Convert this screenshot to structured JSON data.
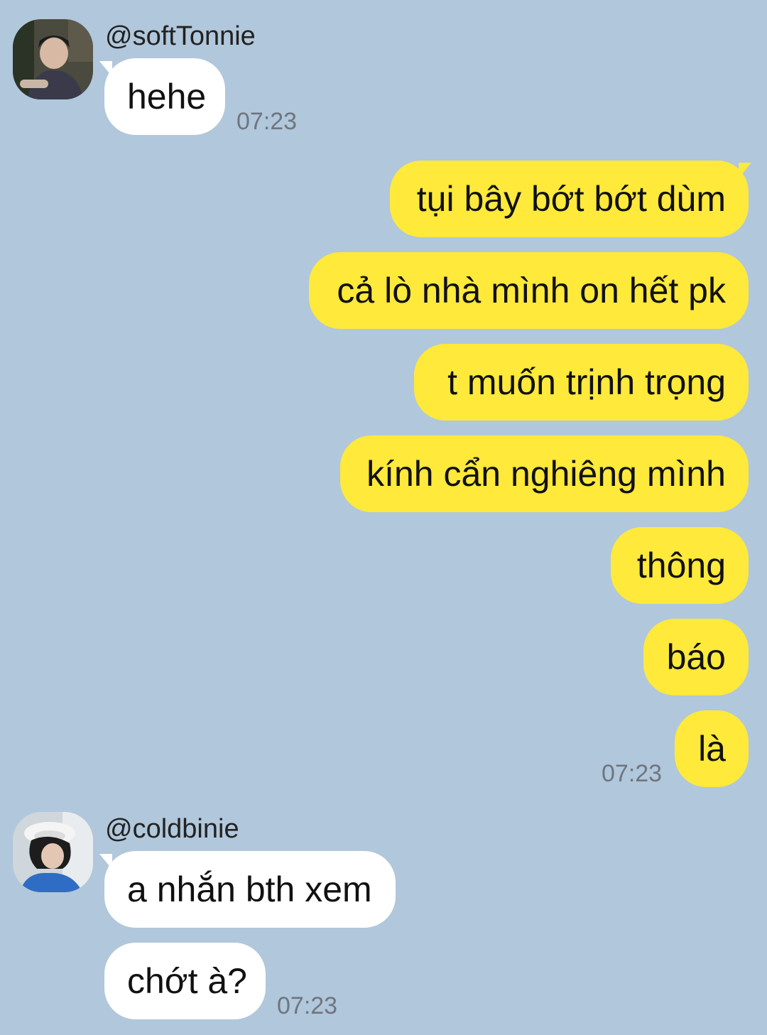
{
  "colors": {
    "background": "#b1c7db",
    "incoming_bubble": "#ffffff",
    "outgoing_bubble": "#ffe93a",
    "timestamp": "#6e7680"
  },
  "groups": [
    {
      "sender": "@softTonnie",
      "avatar": "avatar-photo",
      "messages": [
        "hehe"
      ],
      "time": "07:23"
    },
    {
      "sender": "me",
      "messages": [
        "tụi bây bớt bớt dùm",
        "cả lò nhà mình on hết pk",
        "t muốn trịnh trọng",
        "kính cẩn nghiêng mình",
        "thông",
        "báo",
        "là"
      ],
      "time": "07:23"
    },
    {
      "sender": "@coldbinie",
      "avatar": "avatar-photo",
      "messages": [
        "a nhắn bth xem",
        "chớt à?"
      ],
      "time": "07:23"
    }
  ]
}
